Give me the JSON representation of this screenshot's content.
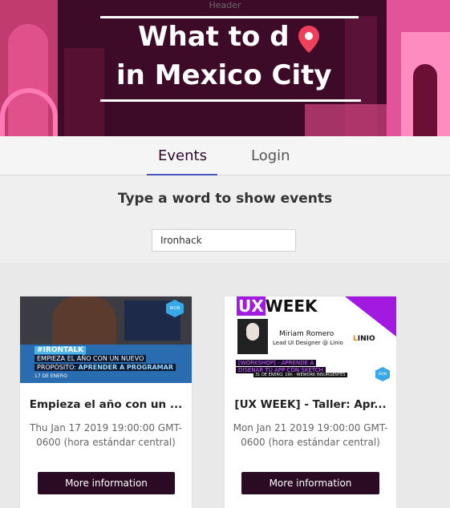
{
  "header": {
    "alt_text": "Header",
    "title_line1": "What to d",
    "title_line2": "in Mexico City",
    "icon": "map-pin-icon"
  },
  "tabs": [
    {
      "label": "Events",
      "active": true
    },
    {
      "label": "Login",
      "active": false
    }
  ],
  "search": {
    "title": "Type a word to show events",
    "value": "Ironhack",
    "placeholder": ""
  },
  "events": [
    {
      "title": "Empieza el año con un ...",
      "date": "Thu Jan 17 2019 19:00:00 GMT-0600 (hora estándar central)",
      "button_label": "More information",
      "image": {
        "tag": "#IRONTALK",
        "line1": "EMPIEZA EL AÑO CON UN NUEVO",
        "line2_prefix": "PROPÓSITO: ",
        "line2_highlight": "APRENDER A PROGRAMAR",
        "line3": "17 DE ENERO",
        "logo": "IRON HACK"
      }
    },
    {
      "title": "[UX WEEK] - Taller: Apr...",
      "date": "Mon Jan 21 2019 19:00:00 GMT-0600 (hora estándar central)",
      "button_label": "More information",
      "image": {
        "ux": "UX",
        "week": "WEEK",
        "speaker_name": "Miriam Romero",
        "speaker_role": "Lead UI Designer @ Linio",
        "brand_prefix": "L",
        "brand_rest": "INIO",
        "workshop_line1": "[WORKSHOP] - APRENDE A",
        "workshop_line2": "DISEÑAR TU APP CON SKETCH",
        "when": "31 DE ENERO, 19h · WEWORK INSURGENTES",
        "logo": "IRON HACK"
      }
    }
  ],
  "colors": {
    "accent": "#4a55c0",
    "button_bg": "#2b0a24",
    "header_dark": "#3d0a28",
    "header_pink": "#e2539a"
  }
}
